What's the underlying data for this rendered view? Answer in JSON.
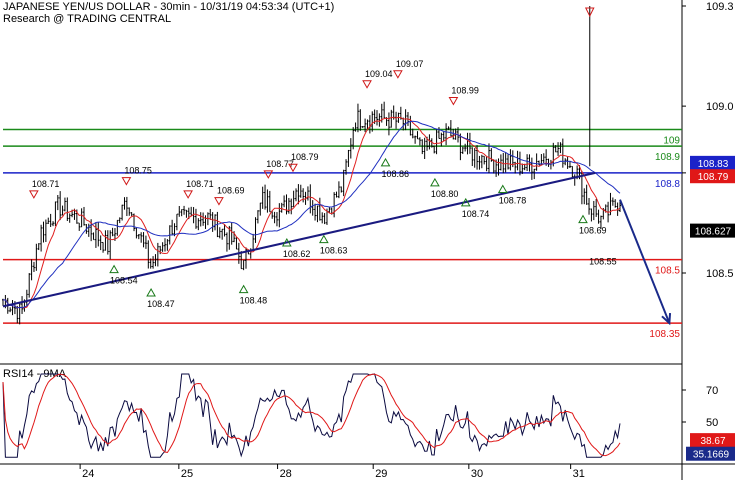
{
  "header": {
    "title": "JAPANESE YEN/US DOLLAR - 30min - 10/31/19 04:53:34 (UTC+1)",
    "subtitle": "Research @ TRADING CENTRAL"
  },
  "colors": {
    "candles": "#000000",
    "ma_fast": "#e02020",
    "ma_slow": "#2030c0",
    "resistance": "#1a8a1a",
    "pivot": "#1a22c8",
    "support": "#e01818",
    "trendline": "#1a1a80",
    "arrow": "#1a2a8a",
    "marker_up": "#1a7a1a",
    "marker_down": "#d01818",
    "current_price_bg": "#000000",
    "rsi_line": "#0a0a40",
    "rsi_signal": "#e01818",
    "rsi_value_bg": "#1a2a8a",
    "rsi_signal_bg": "#e01818"
  },
  "chart_data": [
    {
      "type": "candlestick",
      "ylim": [
        108.25,
        109.32
      ],
      "x_ticks": [
        "24",
        "25",
        "28",
        "29",
        "30",
        "31"
      ],
      "y_ticks": [
        "109.3",
        "109.0",
        "108.8",
        "108.5"
      ],
      "current_price": "108.627",
      "last_close_label": "108.79",
      "pivot_label": "108.83",
      "levels": [
        {
          "label": "109",
          "value": 108.93,
          "kind": "resistance"
        },
        {
          "label": "108.9",
          "value": 108.88,
          "kind": "resistance"
        },
        {
          "label": "108.8",
          "value": 108.8,
          "kind": "pivot"
        },
        {
          "label": "108.5",
          "value": 108.54,
          "kind": "support"
        },
        {
          "label": "108.35",
          "value": 108.35,
          "kind": "support"
        }
      ],
      "annotations": [
        {
          "text": "108.71",
          "value": 108.71,
          "x": 0.05,
          "type": "high"
        },
        {
          "text": "108.75",
          "value": 108.75,
          "x": 0.2,
          "type": "high"
        },
        {
          "text": "108.54",
          "value": 108.54,
          "x": 0.18,
          "type": "low"
        },
        {
          "text": "108.47",
          "value": 108.47,
          "x": 0.24,
          "type": "low"
        },
        {
          "text": "108.71",
          "value": 108.71,
          "x": 0.3,
          "type": "high"
        },
        {
          "text": "108.69",
          "value": 108.69,
          "x": 0.35,
          "type": "high"
        },
        {
          "text": "108.48",
          "value": 108.48,
          "x": 0.39,
          "type": "low"
        },
        {
          "text": "108.77",
          "value": 108.77,
          "x": 0.43,
          "type": "high"
        },
        {
          "text": "108.79",
          "value": 108.79,
          "x": 0.47,
          "type": "high"
        },
        {
          "text": "108.62",
          "value": 108.62,
          "x": 0.46,
          "type": "low"
        },
        {
          "text": "108.63",
          "value": 108.63,
          "x": 0.52,
          "type": "low"
        },
        {
          "text": "109.04",
          "value": 109.04,
          "x": 0.59,
          "type": "high"
        },
        {
          "text": "109.07",
          "value": 109.07,
          "x": 0.64,
          "type": "high"
        },
        {
          "text": "108.86",
          "value": 108.86,
          "x": 0.62,
          "type": "low"
        },
        {
          "text": "108.99",
          "value": 108.99,
          "x": 0.73,
          "type": "high"
        },
        {
          "text": "108.80",
          "value": 108.8,
          "x": 0.7,
          "type": "low"
        },
        {
          "text": "108.74",
          "value": 108.74,
          "x": 0.75,
          "type": "low"
        },
        {
          "text": "108.78",
          "value": 108.78,
          "x": 0.81,
          "type": "low"
        },
        {
          "text": "108.69",
          "value": 108.69,
          "x": 0.94,
          "type": "low"
        },
        {
          "text": "108.55",
          "value": 108.55,
          "x": 0.95,
          "type": "label"
        }
      ],
      "trendline": [
        [
          0.0,
          108.4
        ],
        [
          0.96,
          108.8
        ]
      ],
      "forecast_arrow": [
        [
          1.0,
          108.72
        ],
        [
          1.08,
          108.35
        ]
      ]
    },
    {
      "type": "line",
      "title": "RSI14 - 9MA",
      "ylim": [
        25,
        85
      ],
      "y_ticks": [
        "70",
        "50"
      ],
      "current_value": "35.1669",
      "signal_value": "38.67"
    }
  ]
}
